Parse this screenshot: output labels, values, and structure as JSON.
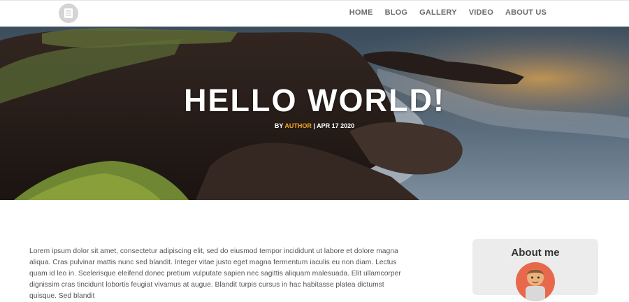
{
  "nav": {
    "items": [
      {
        "label": "HOME"
      },
      {
        "label": "BLOG"
      },
      {
        "label": "GALLERY"
      },
      {
        "label": "VIDEO"
      },
      {
        "label": "ABOUT US"
      }
    ]
  },
  "hero": {
    "title": "HELLO WORLD!",
    "by": "BY",
    "author": "AUTHOR",
    "separator": "|",
    "date": "APR 17 2020"
  },
  "content": {
    "paragraph": "Lorem ipsum dolor sit amet, consectetur adipiscing elit, sed do eiusmod tempor incididunt ut labore et dolore magna aliqua. Cras pulvinar mattis nunc sed blandit. Integer vitae justo eget magna fermentum iaculis eu non diam. Lectus quam id leo in. Scelerisque eleifend donec pretium vulputate sapien nec sagittis aliquam malesuada. Elit ullamcorper dignissim cras tincidunt lobortis feugiat vivamus at augue. Blandit turpis cursus in hac habitasse platea dictumst quisque. Sed blandit"
  },
  "sidebar": {
    "title": "About me"
  },
  "colors": {
    "accent": "#f4a524",
    "avatar_bg": "#e8684e",
    "nav_text": "#6b6b6b"
  },
  "icons": {
    "logo": "menu-list-icon",
    "avatar": "person-avatar"
  }
}
